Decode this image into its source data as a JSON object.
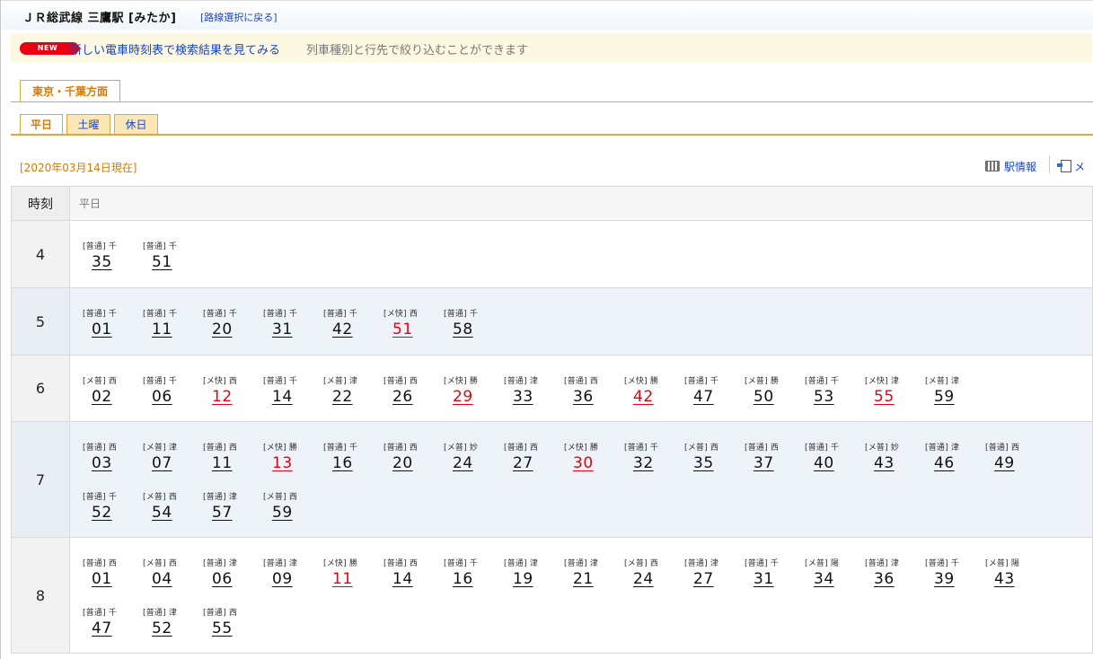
{
  "header": {
    "station_title": "ＪＲ総武線 三鷹駅 [みたか]",
    "back_link": "[路線選択に戻る]"
  },
  "banner": {
    "badge": "NEW",
    "link_text": "新しい電車時刻表で検索結果を見てみる",
    "description": "列車種別と行先で絞り込むことができます"
  },
  "direction_tab": {
    "label": "東京・千葉方面"
  },
  "day_tabs": [
    {
      "label": "平日",
      "active": true
    },
    {
      "label": "土曜",
      "active": false
    },
    {
      "label": "休日",
      "active": false
    }
  ],
  "date_note": "[2020年03月14日現在]",
  "links": {
    "station_info": "駅情報",
    "mail": "メ"
  },
  "table": {
    "hour_header": "時刻",
    "day_header": "平日",
    "rows": [
      {
        "hour": "4",
        "trains": [
          {
            "type": "[普通]",
            "dest": "千",
            "min": "35"
          },
          {
            "type": "[普通]",
            "dest": "千",
            "min": "51"
          }
        ]
      },
      {
        "hour": "5",
        "trains": [
          {
            "type": "[普通]",
            "dest": "千",
            "min": "01"
          },
          {
            "type": "[普通]",
            "dest": "千",
            "min": "11"
          },
          {
            "type": "[普通]",
            "dest": "千",
            "min": "20"
          },
          {
            "type": "[普通]",
            "dest": "千",
            "min": "31"
          },
          {
            "type": "[普通]",
            "dest": "千",
            "min": "42"
          },
          {
            "type": "[メ快]",
            "dest": "西",
            "min": "51",
            "rapid": true
          },
          {
            "type": "[普通]",
            "dest": "千",
            "min": "58"
          }
        ]
      },
      {
        "hour": "6",
        "trains": [
          {
            "type": "[メ普]",
            "dest": "西",
            "min": "02"
          },
          {
            "type": "[普通]",
            "dest": "千",
            "min": "06"
          },
          {
            "type": "[メ快]",
            "dest": "西",
            "min": "12",
            "rapid": true
          },
          {
            "type": "[普通]",
            "dest": "千",
            "min": "14"
          },
          {
            "type": "[メ普]",
            "dest": "津",
            "min": "22"
          },
          {
            "type": "[普通]",
            "dest": "西",
            "min": "26"
          },
          {
            "type": "[メ快]",
            "dest": "勝",
            "min": "29",
            "rapid": true
          },
          {
            "type": "[普通]",
            "dest": "津",
            "min": "33"
          },
          {
            "type": "[普通]",
            "dest": "西",
            "min": "36"
          },
          {
            "type": "[メ快]",
            "dest": "勝",
            "min": "42",
            "rapid": true
          },
          {
            "type": "[普通]",
            "dest": "千",
            "min": "47"
          },
          {
            "type": "[メ普]",
            "dest": "勝",
            "min": "50"
          },
          {
            "type": "[普通]",
            "dest": "千",
            "min": "53"
          },
          {
            "type": "[メ快]",
            "dest": "津",
            "min": "55",
            "rapid": true
          },
          {
            "type": "[メ普]",
            "dest": "津",
            "min": "59"
          }
        ]
      },
      {
        "hour": "7",
        "trains": [
          {
            "type": "[普通]",
            "dest": "西",
            "min": "03"
          },
          {
            "type": "[メ普]",
            "dest": "津",
            "min": "07"
          },
          {
            "type": "[普通]",
            "dest": "西",
            "min": "11"
          },
          {
            "type": "[メ快]",
            "dest": "勝",
            "min": "13",
            "rapid": true
          },
          {
            "type": "[普通]",
            "dest": "千",
            "min": "16"
          },
          {
            "type": "[普通]",
            "dest": "西",
            "min": "20"
          },
          {
            "type": "[メ普]",
            "dest": "妙",
            "min": "24"
          },
          {
            "type": "[普通]",
            "dest": "西",
            "min": "27"
          },
          {
            "type": "[メ快]",
            "dest": "勝",
            "min": "30",
            "rapid": true
          },
          {
            "type": "[普通]",
            "dest": "千",
            "min": "32"
          },
          {
            "type": "[メ普]",
            "dest": "西",
            "min": "35"
          },
          {
            "type": "[普通]",
            "dest": "西",
            "min": "37"
          },
          {
            "type": "[普通]",
            "dest": "千",
            "min": "40"
          },
          {
            "type": "[メ普]",
            "dest": "妙",
            "min": "43"
          },
          {
            "type": "[普通]",
            "dest": "津",
            "min": "46"
          },
          {
            "type": "[普通]",
            "dest": "西",
            "min": "49"
          },
          {
            "type": "[普通]",
            "dest": "千",
            "min": "52"
          },
          {
            "type": "[メ普]",
            "dest": "西",
            "min": "54"
          },
          {
            "type": "[普通]",
            "dest": "津",
            "min": "57"
          },
          {
            "type": "[メ普]",
            "dest": "西",
            "min": "59"
          }
        ]
      },
      {
        "hour": "8",
        "trains": [
          {
            "type": "[普通]",
            "dest": "西",
            "min": "01"
          },
          {
            "type": "[メ普]",
            "dest": "西",
            "min": "04"
          },
          {
            "type": "[普通]",
            "dest": "津",
            "min": "06"
          },
          {
            "type": "[普通]",
            "dest": "津",
            "min": "09"
          },
          {
            "type": "[メ快]",
            "dest": "勝",
            "min": "11",
            "rapid": true
          },
          {
            "type": "[普通]",
            "dest": "西",
            "min": "14"
          },
          {
            "type": "[普通]",
            "dest": "千",
            "min": "16"
          },
          {
            "type": "[普通]",
            "dest": "津",
            "min": "19"
          },
          {
            "type": "[普通]",
            "dest": "津",
            "min": "21"
          },
          {
            "type": "[メ普]",
            "dest": "西",
            "min": "24"
          },
          {
            "type": "[普通]",
            "dest": "津",
            "min": "27"
          },
          {
            "type": "[普通]",
            "dest": "千",
            "min": "31"
          },
          {
            "type": "[メ普]",
            "dest": "陽",
            "min": "34"
          },
          {
            "type": "[普通]",
            "dest": "津",
            "min": "36"
          },
          {
            "type": "[普通]",
            "dest": "千",
            "min": "39"
          },
          {
            "type": "[メ普]",
            "dest": "陽",
            "min": "43"
          },
          {
            "type": "[普通]",
            "dest": "千",
            "min": "47"
          },
          {
            "type": "[普通]",
            "dest": "津",
            "min": "52"
          },
          {
            "type": "[普通]",
            "dest": "西",
            "min": "55"
          }
        ]
      }
    ]
  }
}
